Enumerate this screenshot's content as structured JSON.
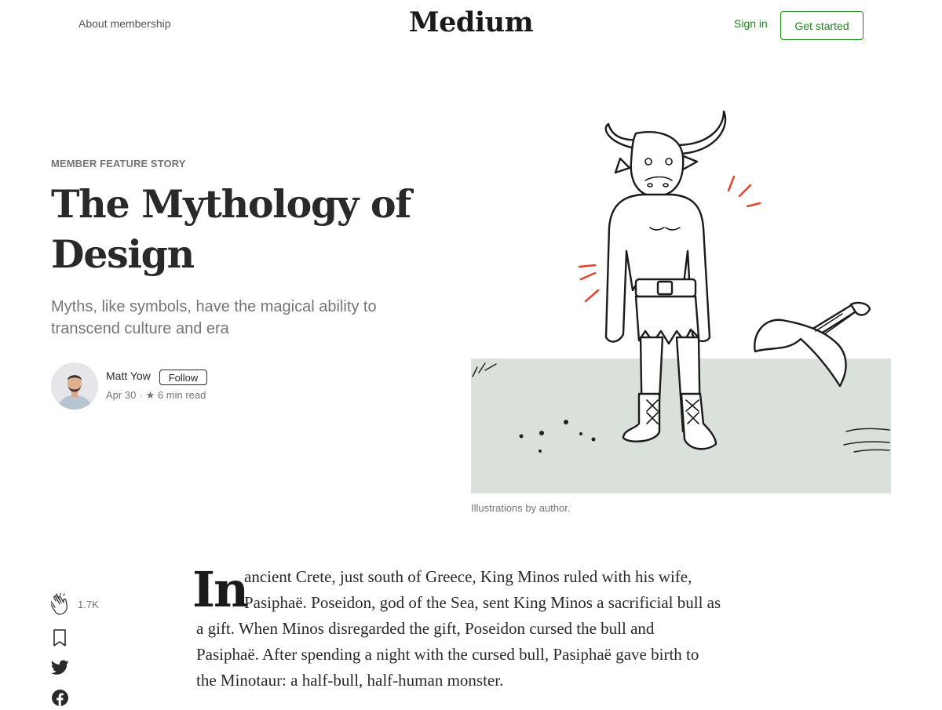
{
  "header": {
    "about_label": "About membership",
    "logo_text": "Medium",
    "signin_label": "Sign in",
    "get_started_label": "Get started",
    "accent_color": "#1a8917"
  },
  "story": {
    "kicker": "MEMBER FEATURE STORY",
    "title": "The Mythology of Design",
    "subtitle": "Myths, like symbols, have the magical ability to transcend culture and era"
  },
  "author": {
    "name": "Matt Yow",
    "follow_label": "Follow",
    "date": "Apr 30",
    "separator": "·",
    "star": "★",
    "read_time": "6 min read",
    "avatar_icon": "person-avatar"
  },
  "figure": {
    "illustration_icon": "minotaur-illustration",
    "caption": "Illustrations by author."
  },
  "actions": {
    "clap_icon": "clap-icon",
    "clap_count": "1.7K",
    "bookmark_icon": "bookmark-icon",
    "twitter_icon": "twitter-icon",
    "facebook_icon": "facebook-icon"
  },
  "article": {
    "drop_cap": "In",
    "lines": [
      "ancient Crete, just south of Greece, King Minos ruled with his wife,",
      "Pasiphaë. Poseidon, god of the Sea, sent King Minos a sacrificial bull as",
      "a gift. When Minos disregarded the gift, Poseidon cursed the bull and",
      "Pasiphaë. After spending a night with the cursed bull, Pasiphaë gave birth to",
      "the Minotaur: a half-bull, half-human monster."
    ]
  }
}
